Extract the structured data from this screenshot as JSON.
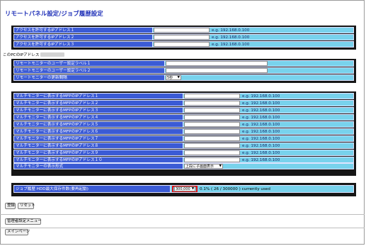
{
  "page": {
    "title": "リモートパネル設定/ジョブ履歴設定"
  },
  "access": {
    "rows": [
      {
        "label": "アクセスを許可するIPアドレス１",
        "value": "",
        "example": "e.g. 192.168.0.100"
      },
      {
        "label": "アクセスを許可するIPアドレス２",
        "value": "",
        "example": "e.g. 192.168.0.100"
      },
      {
        "label": "アクセスを許可するIPアドレス３",
        "value": "",
        "example": "e.g. 192.168.0.100"
      }
    ]
  },
  "pc_ip": {
    "label": "このPCのIPアドレス"
  },
  "remote_monitor": {
    "label1": "リモートモニターのユーザー設定ラベル１",
    "label2": "リモートモニターのユーザー設定ラベル２",
    "interval_label": "リモートモニターの更新間隔",
    "interval_value": "5秒"
  },
  "multi_monitor": {
    "rows": [
      {
        "label": "マルチモニターに表示するMFPのIPアドレス１",
        "example": "e.g. 192.168.0.100"
      },
      {
        "label": "マルチモニターに表示するMFPのIPアドレス２",
        "example": "e.g. 192.168.0.100"
      },
      {
        "label": "マルチモニターに表示するMFPのIPアドレス３",
        "example": "e.g. 192.168.0.100"
      },
      {
        "label": "マルチモニターに表示するMFPのIPアドレス４",
        "example": "e.g. 192.168.0.100"
      },
      {
        "label": "マルチモニターに表示するMFPのIPアドレス５",
        "example": "e.g. 192.168.0.100"
      },
      {
        "label": "マルチモニターに表示するMFPのIPアドレス６",
        "example": "e.g. 192.168.0.100"
      },
      {
        "label": "マルチモニターに表示するMFPのIPアドレス７",
        "example": "e.g. 192.168.0.100"
      },
      {
        "label": "マルチモニターに表示するMFPのIPアドレス８",
        "example": "e.g. 192.168.0.100"
      },
      {
        "label": "マルチモニターに表示するMFPのIPアドレス９",
        "example": "e.g. 192.168.0.100"
      },
      {
        "label": "マルチモニターに表示するMFPのIPアドレス１０",
        "example": "e.g. 192.168.0.100"
      }
    ],
    "display_label": "マルチモニターの表示形式",
    "display_value": "上段に子画面表示"
  },
  "job_history": {
    "label": "ジョブ履歴 HDD最大保存件数(要再起動)",
    "select_value": "300,000",
    "usage_text": "0.1% ( 26 / 300000 ) currently used"
  },
  "buttons": {
    "register": "登録",
    "reset": "リセット",
    "admin_menu": "管理者設定メニュー",
    "main_page": "メインページ"
  }
}
